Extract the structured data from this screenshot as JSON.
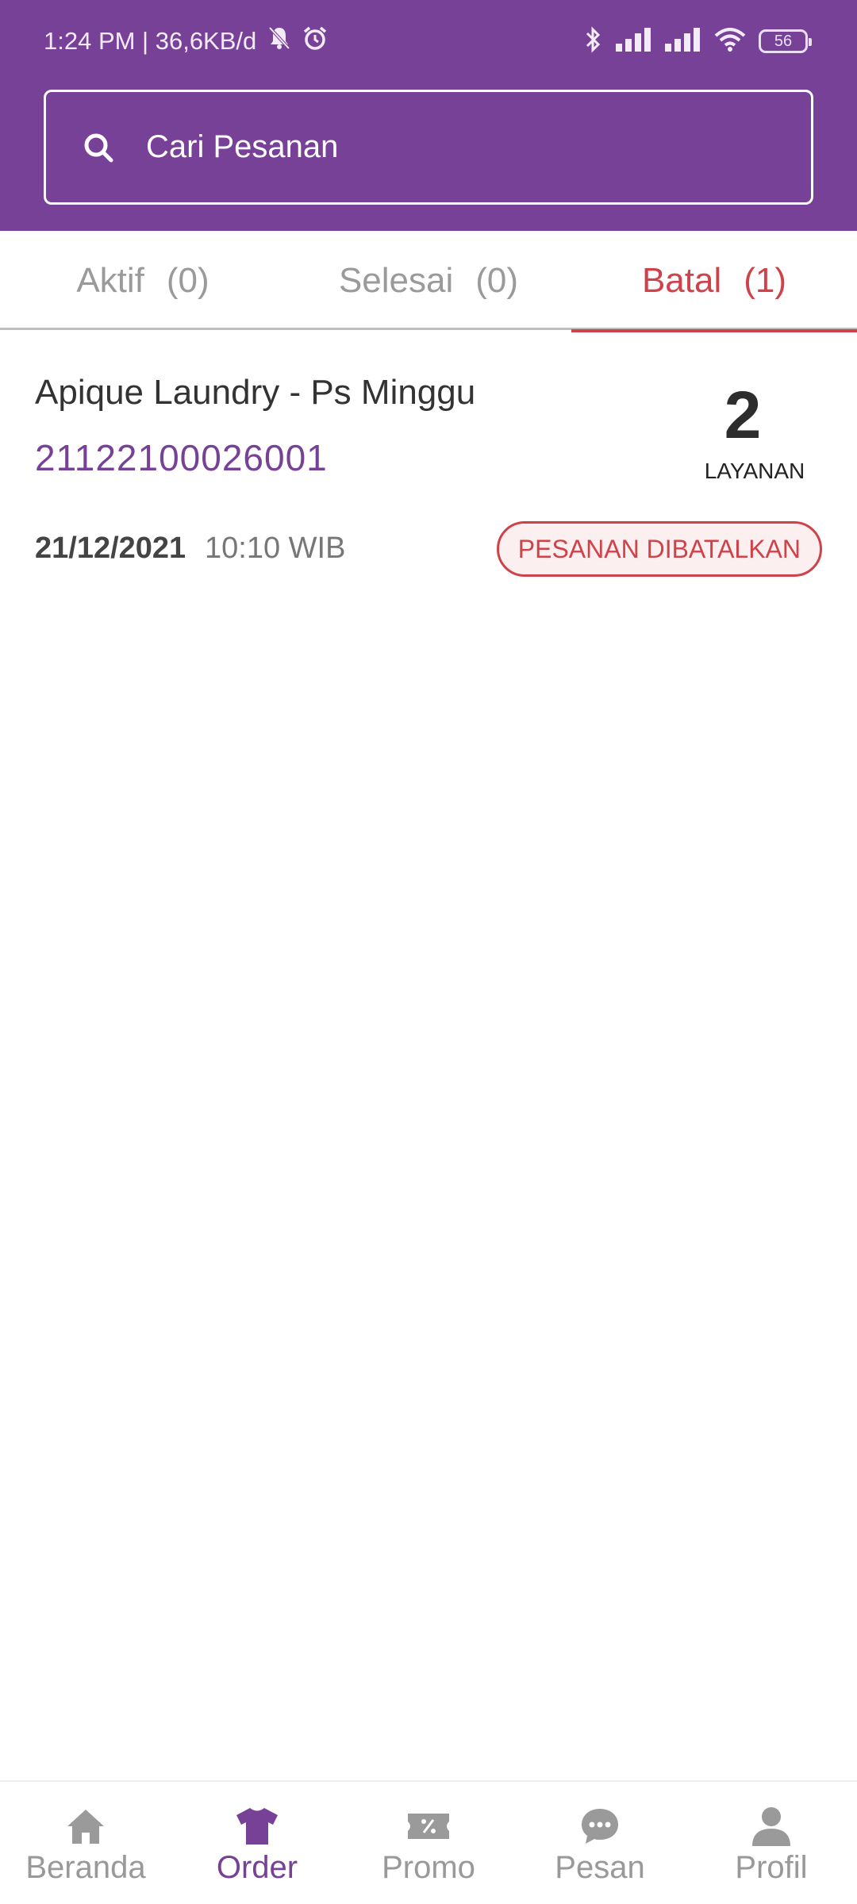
{
  "status_bar": {
    "time_speed": "1:24 PM | 36,6KB/d",
    "battery": "56"
  },
  "search": {
    "placeholder": "Cari Pesanan"
  },
  "tabs": [
    {
      "label": "Aktif",
      "count": "(0)"
    },
    {
      "label": "Selesai",
      "count": "(0)"
    },
    {
      "label": "Batal",
      "count": "(1)"
    }
  ],
  "order": {
    "store_name": "Apique Laundry - Ps Minggu",
    "order_id": "21122100026001",
    "service_count": "2",
    "service_label": "LAYANAN",
    "date": "21/12/2021",
    "time": "10:10 WIB",
    "status": "PESANAN DIBATALKAN"
  },
  "nav": [
    {
      "label": "Beranda",
      "icon": "home-icon"
    },
    {
      "label": "Order",
      "icon": "shirt-icon"
    },
    {
      "label": "Promo",
      "icon": "ticket-icon"
    },
    {
      "label": "Pesan",
      "icon": "chat-icon"
    },
    {
      "label": "Profil",
      "icon": "user-icon"
    }
  ],
  "colors": {
    "primary": "#774197",
    "danger": "#d0424a",
    "inactive": "#999999"
  }
}
